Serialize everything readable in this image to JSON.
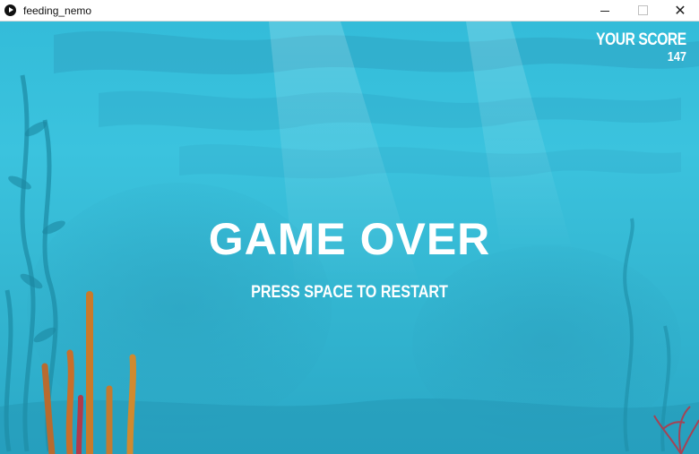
{
  "window": {
    "title": "feeding_nemo",
    "minimize_label": "",
    "maximize_label": "",
    "close_label": "✕"
  },
  "hud": {
    "score_label": "YOUR SCORE",
    "score_value": "147"
  },
  "overlay": {
    "headline": "GAME OVER",
    "prompt": "PRESS SPACE TO RESTART"
  },
  "colors": {
    "water_top": "#33bcd9",
    "water_bottom": "#2aa8c6",
    "text": "#ffffff",
    "coral_orange": "#c97a2a",
    "coral_red": "#b23a4a"
  }
}
